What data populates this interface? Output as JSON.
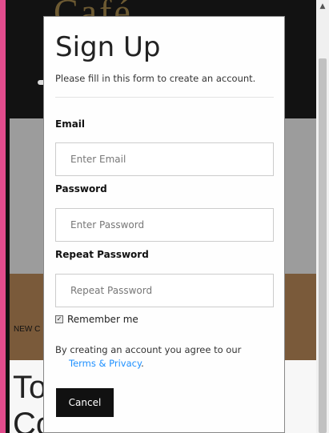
{
  "modal": {
    "title": "Sign Up",
    "subtitle": "Please fill in this form to create an account.",
    "email": {
      "label": "Email",
      "placeholder": "Enter Email",
      "value": ""
    },
    "password": {
      "label": "Password",
      "placeholder": "Enter Password",
      "value": ""
    },
    "repeat_password": {
      "label": "Repeat Password",
      "placeholder": "Repeat Password",
      "value": ""
    },
    "remember": {
      "label": "Remember me",
      "checked": true
    },
    "terms": {
      "text": "By creating an account you agree to our",
      "link_text": "Terms & Privacy",
      "suffix": "."
    },
    "cancel_label": "Cancel"
  },
  "background": {
    "new_label": "NEW C",
    "heading_line1": "To",
    "heading_line2": "Co",
    "logo_text": "Café"
  },
  "colors": {
    "link": "#1e90ff",
    "cancel_bg": "#111111",
    "accent_strip": "#e24c8d"
  },
  "icons": {
    "scroll_up": "up-arrow-icon",
    "checkbox": "checkbox-checked-icon"
  }
}
